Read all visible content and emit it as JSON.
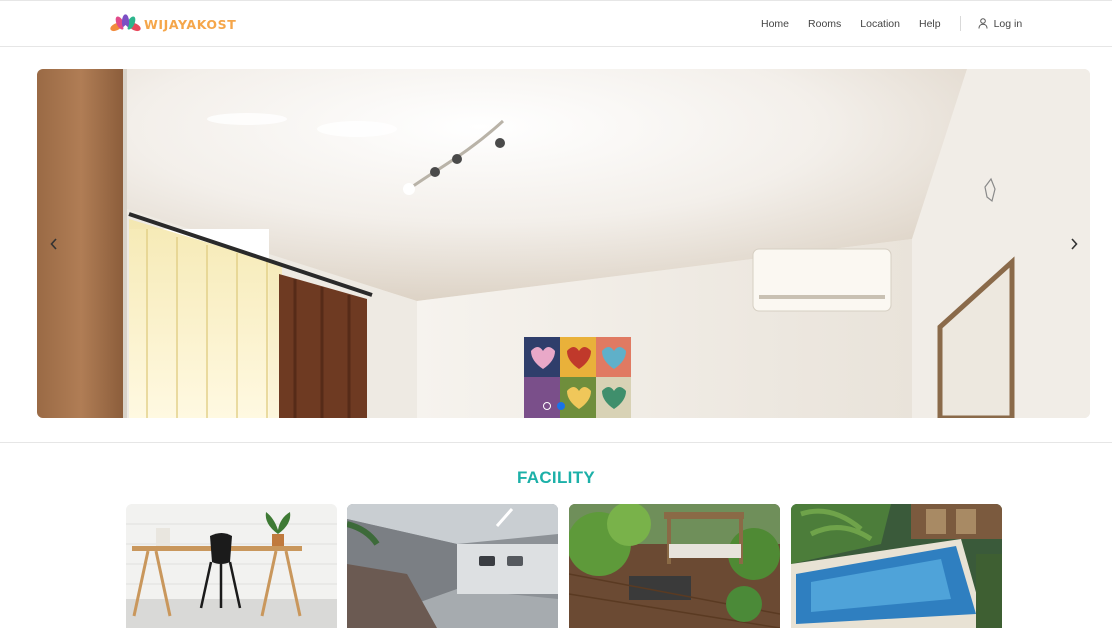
{
  "header": {
    "brand": "WIJAYAKOST",
    "nav": [
      "Home",
      "Rooms",
      "Location",
      "Help"
    ],
    "login_label": "Log in"
  },
  "carousel": {
    "prev_icon": "chevron-left-icon",
    "next_icon": "chevron-right-icon",
    "slides_count": 3,
    "active_slide": 2
  },
  "facility": {
    "title": "FACILITY",
    "cards": [
      "workspace",
      "parking garage",
      "garden terrace",
      "swimming pool"
    ]
  },
  "colors": {
    "brand_orange": "#f5a64a",
    "accent_teal": "#1cb0a8",
    "active_dot": "#1a73e8"
  }
}
